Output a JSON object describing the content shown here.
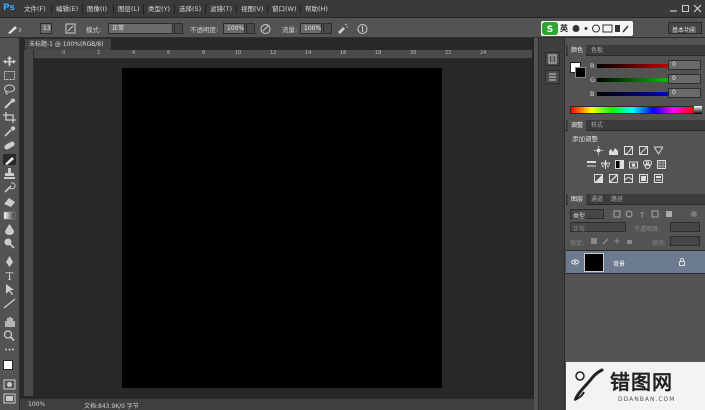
{
  "app": {
    "logo": "Ps",
    "menus": [
      "文件(F)",
      "编辑(E)",
      "图像(I)",
      "图层(L)",
      "类型(Y)",
      "选择(S)",
      "滤镜(T)",
      "视图(V)",
      "窗口(W)",
      "帮助(H)"
    ]
  },
  "options": {
    "brush_size": "13",
    "mode_label": "模式:",
    "mode_value": "正常",
    "opacity_label": "不透明度:",
    "opacity_value": "100%",
    "flow_label": "流量:",
    "flow_value": "100%",
    "ime_label": "英",
    "workspace": "基本功能"
  },
  "document": {
    "tab_title": "未标题-1 @ 100%(RGB/8)",
    "ruler_ticks": [
      "0",
      "2",
      "4",
      "6",
      "8",
      "10",
      "12",
      "14",
      "16",
      "18",
      "20",
      "22",
      "24"
    ],
    "zoom": "100%",
    "doc_info": "文档:843.9K/0 字节"
  },
  "color_panel": {
    "tabs": [
      "颜色",
      "色板"
    ],
    "channels": [
      {
        "label": "R",
        "value": "0",
        "color": "#e03030"
      },
      {
        "label": "G",
        "value": "0",
        "color": "#30b030"
      },
      {
        "label": "B",
        "value": "0",
        "color": "#3050e0"
      }
    ]
  },
  "adjust_panel": {
    "tabs": [
      "调整",
      "样式"
    ],
    "heading": "添加调整"
  },
  "layers_panel": {
    "tabs": [
      "图层",
      "通道",
      "路径"
    ],
    "filter_label": "类型",
    "blend_mode": "正常",
    "opacity_label": "不透明度:",
    "lock_label": "锁定:",
    "fill_label": "填充:",
    "layer_name": "背景"
  },
  "watermark": {
    "main": "错图网",
    "sub": "DDANBAN.COM"
  },
  "colors": {
    "accent_blue": "#31a8ff",
    "selected_layer": "#6b7a8f",
    "sogou_green": "#2fa52f"
  }
}
